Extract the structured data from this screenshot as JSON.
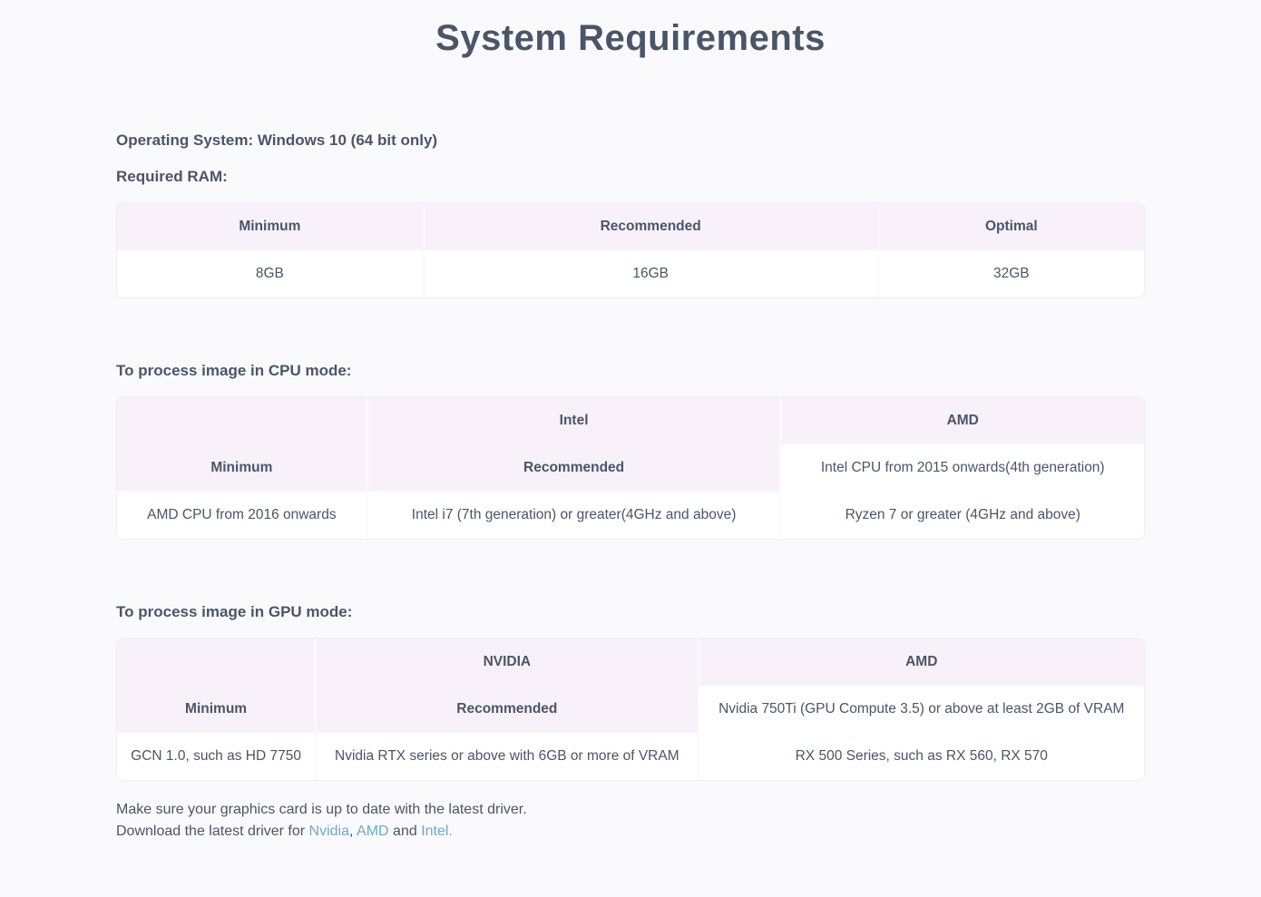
{
  "title": "System Requirements",
  "os_line": "Operating System: Windows 10 (64 bit only)",
  "ram": {
    "heading": "Required RAM:",
    "headers": [
      "Minimum",
      "Recommended",
      "Optimal"
    ],
    "values": [
      "8GB",
      "16GB",
      "32GB"
    ]
  },
  "cpu": {
    "heading": "To process image in CPU mode:",
    "headers": [
      "",
      "Intel",
      "AMD"
    ],
    "rows": [
      [
        "Minimum",
        "Recommended",
        "Intel CPU from 2015 onwards(4th generation)"
      ],
      [
        "AMD CPU from 2016 onwards",
        "Intel i7 (7th generation) or greater(4GHz and above)",
        "Ryzen 7 or greater (4GHz and above)"
      ]
    ]
  },
  "gpu": {
    "heading": "To process image in GPU mode:",
    "headers": [
      "",
      "NVIDIA",
      "AMD"
    ],
    "rows": [
      [
        "Minimum",
        "Recommended",
        "Nvidia 750Ti (GPU Compute 3.5) or above at least 2GB of VRAM"
      ],
      [
        "GCN 1.0, such as HD 7750",
        "Nvidia RTX series or above with 6GB or more of VRAM",
        "RX 500 Series, such as RX 560, RX 570"
      ]
    ]
  },
  "footer": {
    "line1": "Make sure your graphics card is up to date with the latest driver.",
    "line2_prefix": "Download the latest driver for ",
    "link_nvidia": "Nvidia",
    "sep1": ", ",
    "link_amd": "AMD",
    "sep2": " and ",
    "link_intel": "Intel.",
    "line2_suffix": ""
  }
}
